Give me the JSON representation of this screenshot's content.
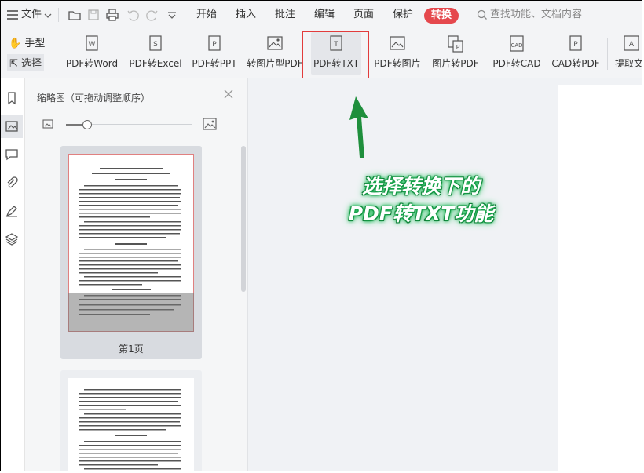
{
  "menubar": {
    "file_label": "文件",
    "tabs": [
      "开始",
      "插入",
      "批注",
      "编辑",
      "页面",
      "保护"
    ],
    "active_tab": "转换",
    "search_placeholder": "查找功能、文档内容"
  },
  "toolbar": {
    "hand_label": "手型",
    "select_label": "选择",
    "tools": [
      {
        "label": "PDF转Word",
        "icon": "pdf-to-word-icon"
      },
      {
        "label": "PDF转Excel",
        "icon": "pdf-to-excel-icon"
      },
      {
        "label": "PDF转PPT",
        "icon": "pdf-to-ppt-icon"
      },
      {
        "label": "转图片型PDF",
        "icon": "to-image-pdf-icon"
      },
      {
        "label": "PDF转TXT",
        "icon": "pdf-to-txt-icon",
        "active": true
      },
      {
        "label": "PDF转图片",
        "icon": "pdf-to-image-icon"
      },
      {
        "label": "图片转PDF",
        "icon": "image-to-pdf-icon"
      },
      {
        "label": "PDF转CAD",
        "icon": "pdf-to-cad-icon"
      },
      {
        "label": "CAD转PDF",
        "icon": "cad-to-pdf-icon"
      },
      {
        "label": "提取文",
        "icon": "extract-text-icon"
      }
    ]
  },
  "sidebar": {
    "panel_title": "缩略图（可拖动调整顺序）",
    "page1_label": "第1页"
  },
  "annotation": {
    "line1": "选择转换下的",
    "line2": "PDF转TXT功能"
  },
  "colors": {
    "accent_red": "#e5484d",
    "highlight_box": "#e23c3c",
    "arrow_green": "#16a34a"
  }
}
